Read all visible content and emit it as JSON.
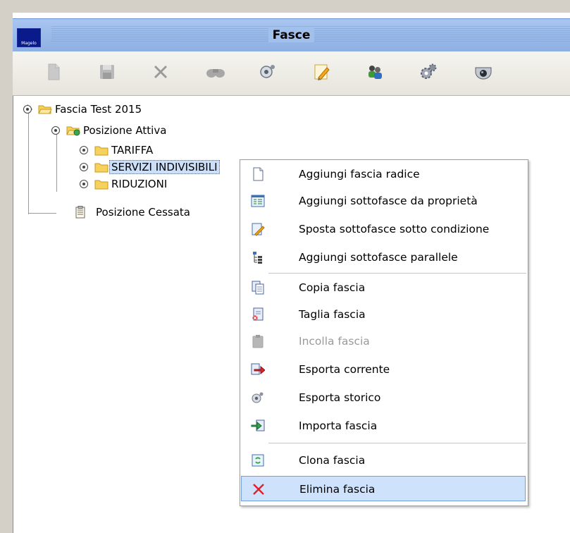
{
  "window": {
    "title": "Fasce",
    "logo_text": "Magelo"
  },
  "toolbar": {
    "buttons": [
      {
        "name": "new-document-button",
        "icon": "document-icon",
        "enabled": false
      },
      {
        "name": "save-button",
        "icon": "floppy-disk-icon",
        "enabled": false
      },
      {
        "name": "delete-button",
        "icon": "close-icon",
        "enabled": false
      },
      {
        "name": "search-button",
        "icon": "binoculars-icon",
        "enabled": false
      },
      {
        "name": "export-history-button",
        "icon": "export-history-icon",
        "enabled": true
      },
      {
        "name": "edit-button",
        "icon": "edit-pencil-icon",
        "enabled": true
      },
      {
        "name": "users-button",
        "icon": "users-icon",
        "enabled": true
      },
      {
        "name": "settings-button",
        "icon": "gears-icon",
        "enabled": true
      },
      {
        "name": "camera-button",
        "icon": "security-camera-icon",
        "enabled": true
      }
    ]
  },
  "tree": {
    "root": {
      "label": "Fascia Test 2015"
    },
    "attiva": {
      "label": "Posizione Attiva"
    },
    "tariffa": {
      "label": "TARIFFA"
    },
    "servizi": {
      "label": "SERVIZI INDIVISIBILI",
      "selected": true
    },
    "riduzioni": {
      "label": "RIDUZIONI"
    },
    "cessata": {
      "label": "Posizione Cessata"
    }
  },
  "context_menu": {
    "items": [
      {
        "label": "Aggiungi fascia radice",
        "icon": "blank-page-icon",
        "enabled": true
      },
      {
        "label": "Aggiungi sottofasce da proprietà",
        "icon": "properties-list-icon",
        "enabled": true
      },
      {
        "label": "Sposta sottofasce sotto condizione",
        "icon": "move-edit-icon",
        "enabled": true
      },
      {
        "label": "Aggiungi sottofasce parallele",
        "icon": "parallel-tree-icon",
        "enabled": true
      },
      {
        "label": "Copia fascia",
        "icon": "copy-icon",
        "enabled": true
      },
      {
        "label": "Taglia fascia",
        "icon": "cut-icon",
        "enabled": true
      },
      {
        "label": "Incolla fascia",
        "icon": "paste-icon",
        "enabled": false
      },
      {
        "label": "Esporta corrente",
        "icon": "export-arrow-icon",
        "enabled": true
      },
      {
        "label": "Esporta storico",
        "icon": "export-history-icon",
        "enabled": true
      },
      {
        "label": "Importa fascia",
        "icon": "import-arrow-icon",
        "enabled": true
      },
      {
        "label": "Clona fascia",
        "icon": "clone-icon",
        "enabled": true
      },
      {
        "label": "Elimina fascia",
        "icon": "delete-x-icon",
        "enabled": true,
        "highlighted": true
      }
    ]
  },
  "colors": {
    "title_bar": "#9cbbe9",
    "selection": "#cbe0f8",
    "menu_highlight": "#cfe2fb",
    "folder": "#f6d25c",
    "delete_red": "#e0222a"
  }
}
